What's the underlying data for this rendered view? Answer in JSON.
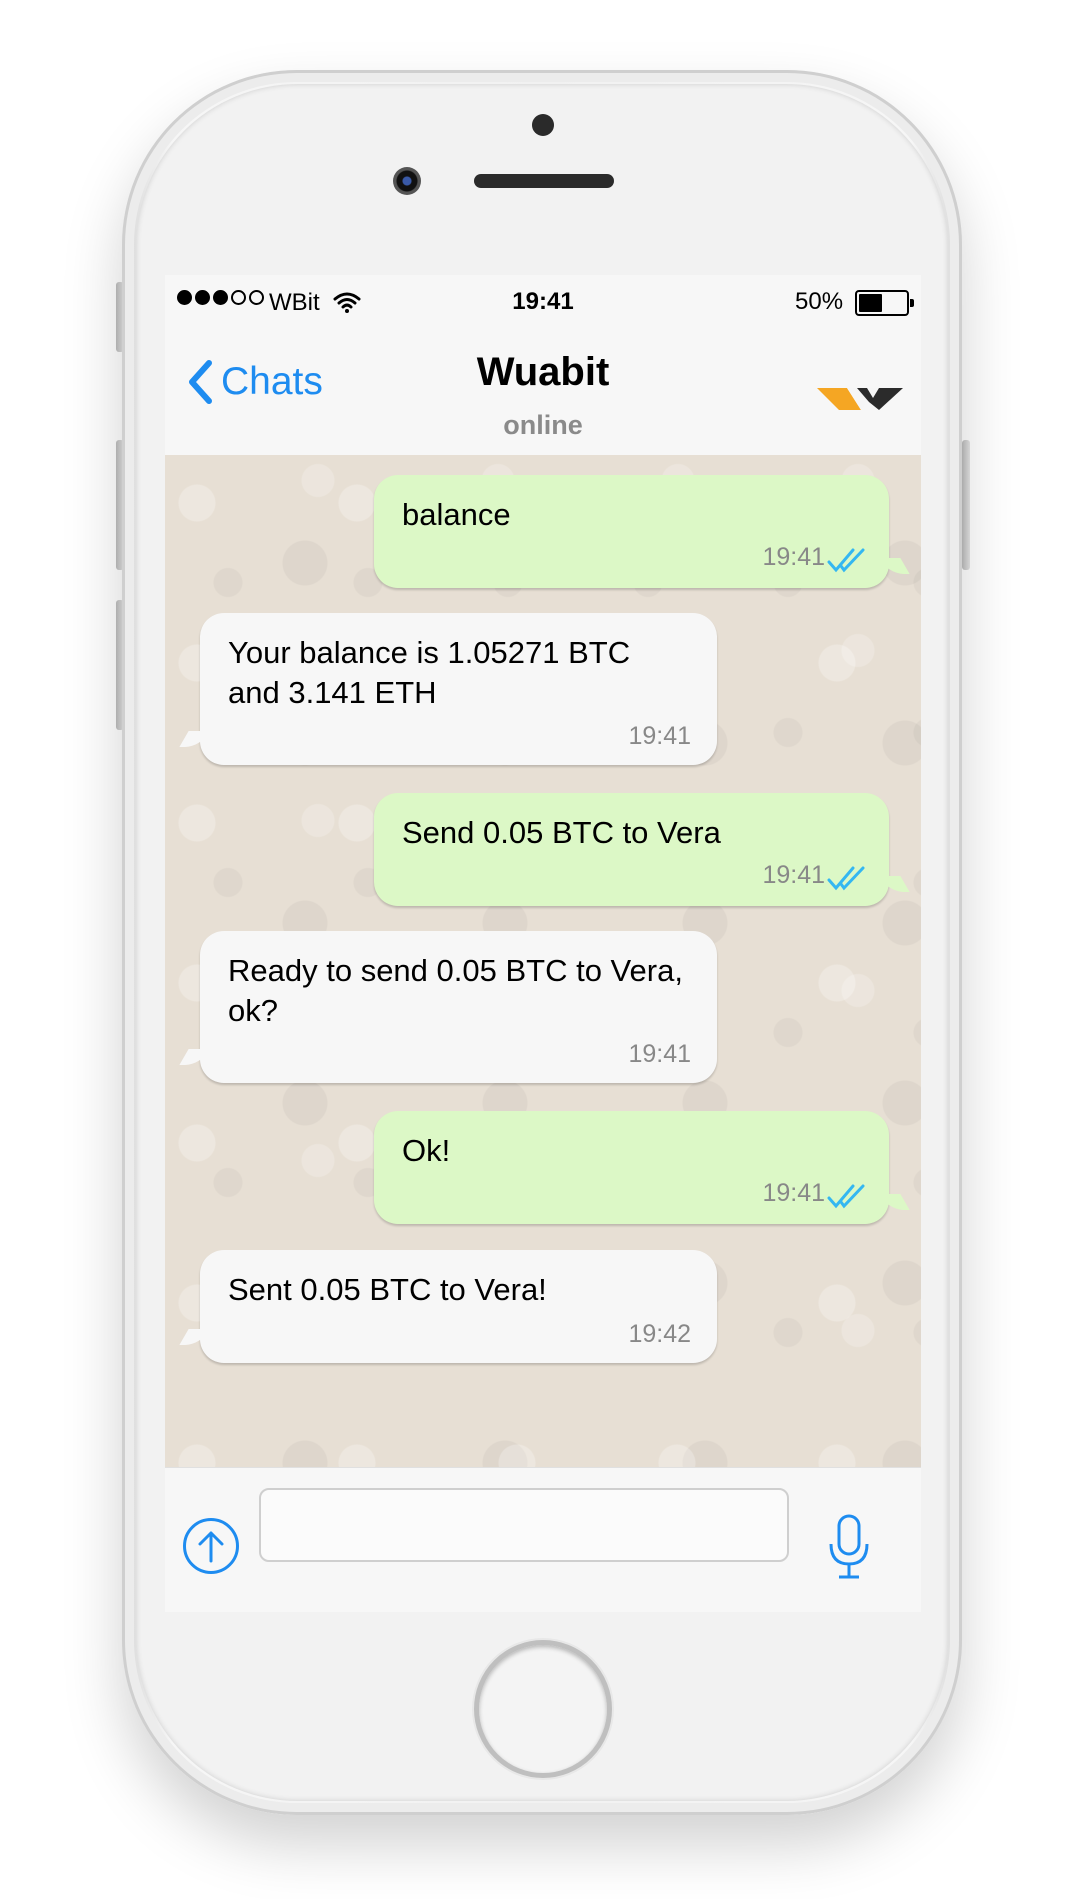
{
  "status_bar": {
    "carrier": "WBit",
    "time": "19:41",
    "battery_percent_label": "50%",
    "battery_level": 0.5,
    "signal_bars_filled": 3,
    "signal_bars_total": 5
  },
  "nav": {
    "back_label": "Chats",
    "title": "Wuabit",
    "subtitle": "online"
  },
  "messages": [
    {
      "direction": "out",
      "text": "balance",
      "time": "19:41",
      "read": true
    },
    {
      "direction": "in",
      "text": "Your balance is 1.05271 BTC and 3.141 ETH",
      "time": "19:41"
    },
    {
      "direction": "out",
      "text": "Send 0.05 BTC to Vera",
      "time": "19:41",
      "read": true
    },
    {
      "direction": "in",
      "text": "Ready to send 0.05 BTC to Vera, ok?",
      "time": "19:41"
    },
    {
      "direction": "out",
      "text": "Ok!",
      "time": "19:41",
      "read": true
    },
    {
      "direction": "in",
      "text": "Sent 0.05 BTC to Vera!",
      "time": "19:42"
    }
  ],
  "input": {
    "value": "",
    "placeholder": ""
  },
  "colors": {
    "accent": "#1e8cf0",
    "outgoing_bubble": "#dcf8c6",
    "incoming_bubble": "#f7f7f7",
    "read_receipt": "#34b7f1",
    "logo_orange": "#f5a623",
    "logo_dark": "#2b2b2b"
  },
  "icons": {
    "back": "chevron-left-icon",
    "wifi": "wifi-icon",
    "battery": "battery-icon",
    "read_receipt": "double-check-icon",
    "share": "arrow-up-circle-icon",
    "mic": "microphone-icon",
    "brand": "wuabit-logo"
  }
}
